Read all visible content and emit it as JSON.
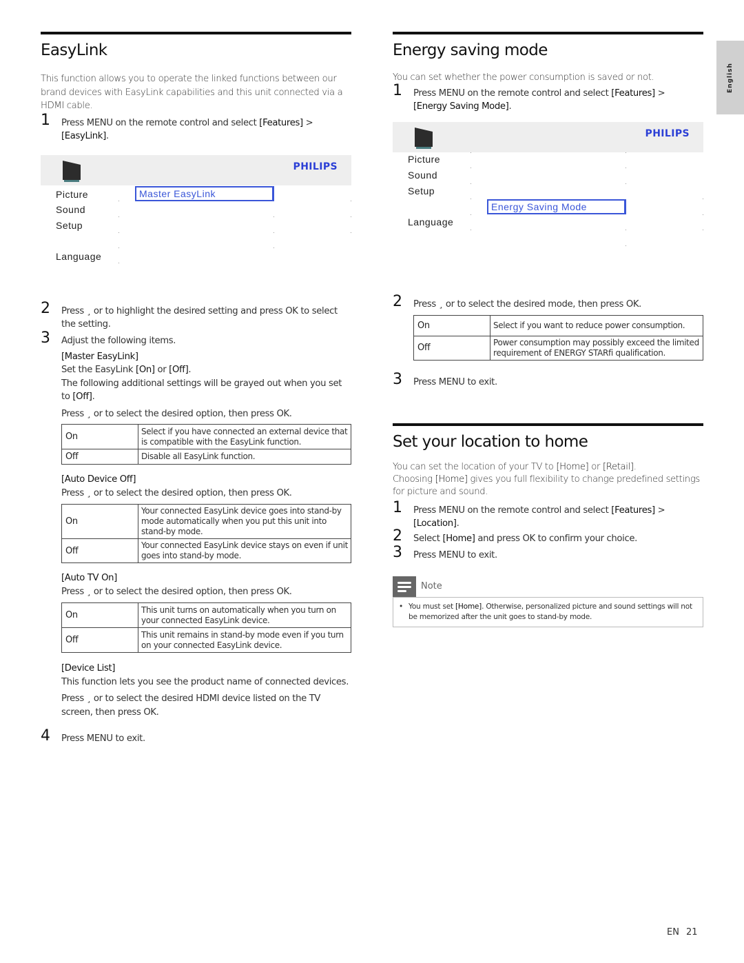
{
  "easylink": {
    "title": "EasyLink",
    "intro": "This function allows you to operate the linked functions between our brand devices with EasyLink capabilities and this unit connected via a HDMI cable.",
    "step1": {
      "num": "1",
      "pre": "Press MENU on the remote control and select ",
      "features": "[Features]",
      "mid": " > ",
      "target": "[EasyLink]",
      "post": "."
    },
    "menu": {
      "brand": "PHILIPS",
      "items": [
        "Picture",
        "Sound",
        "Setup",
        "Language"
      ],
      "highlighted": "Master EasyLink"
    },
    "step2": {
      "num": "2",
      "text": "Press ¸  or     to highlight the desired setting and press OK to select the setting."
    },
    "step3": {
      "num": "3",
      "text": "Adjust the following items."
    },
    "master": {
      "title": "[Master EasyLink]",
      "line1_pre": "Set the EasyLink ",
      "on": "[On]",
      "or": " or ",
      "off": "[Off]",
      "line1_post": ".",
      "line2_pre": "The following additional settings will be grayed out when you set to ",
      "line2_post": ".",
      "press": "Press ¸  or     to select the desired option, then press OK.",
      "rows": [
        {
          "key": "On",
          "desc": "Select if you have connected an external device that is compatible with the EasyLink function."
        },
        {
          "key": "Off",
          "desc": "Disable all EasyLink function."
        }
      ]
    },
    "auto_device_off": {
      "title": "[Auto Device Off]",
      "press": "Press ¸  or     to select the desired option, then press OK.",
      "rows": [
        {
          "key": "On",
          "desc": "Your connected EasyLink device goes into stand-by mode automatically when you put this unit into stand-by mode."
        },
        {
          "key": "Off",
          "desc": "Your connected EasyLink device stays on even if unit goes into stand-by mode."
        }
      ]
    },
    "auto_tv_on": {
      "title": "[Auto TV On]",
      "press": "Press ¸  or     to select the desired option, then press OK.",
      "rows": [
        {
          "key": "On",
          "desc": "This unit turns on automatically when you turn on your connected EasyLink device."
        },
        {
          "key": "Off",
          "desc": "This unit remains in stand-by mode even if you turn on your connected EasyLink device."
        }
      ]
    },
    "device_list": {
      "title": "[Device List]",
      "desc": "This function lets you see the product name of connected devices.",
      "press": "Press ¸  or     to select the desired HDMI device listed on the TV screen, then press OK."
    },
    "step4": {
      "num": "4",
      "text": "Press MENU to exit."
    }
  },
  "energy": {
    "title": "Energy saving mode",
    "intro": "You can set whether the power consumption is saved or not.",
    "step1": {
      "num": "1",
      "pre": "Press MENU on the remote control and select ",
      "features": "[Features]",
      "mid": " > ",
      "target": "[Energy Saving Mode]",
      "post": "."
    },
    "menu": {
      "brand": "PHILIPS",
      "items": [
        "Picture",
        "Sound",
        "Setup",
        "Language"
      ],
      "highlighted": "Energy Saving Mode"
    },
    "step2": {
      "num": "2",
      "text": "Press ¸  or     to select the desired mode, then press OK."
    },
    "rows": [
      {
        "key": "On",
        "desc": "Select if you want to reduce power consumption."
      },
      {
        "key": "Off",
        "desc": "Power consumption may possibly exceed the limited requirement of ENERGY STARfi qualification."
      }
    ],
    "step3": {
      "num": "3",
      "text": "Press MENU to exit."
    }
  },
  "location": {
    "title": "Set your location to home",
    "intro1_pre": "You can set the location of your TV to ",
    "home": "[Home]",
    "or": " or ",
    "retail": "[Retail]",
    "intro1_post": ".",
    "intro2_pre": "Choosing ",
    "intro2_post": " gives you full flexibility to change predefined settings for picture and sound.",
    "step1": {
      "num": "1",
      "pre": "Press MENU on the remote control and select ",
      "features": "[Features]",
      "mid": " > ",
      "target": "[Location]",
      "post": "."
    },
    "step2": {
      "num": "2",
      "pre": "Select ",
      "post": " and press OK to confirm your choice."
    },
    "step3": {
      "num": "3",
      "text": "Press MENU to exit."
    },
    "note": {
      "label": "Note",
      "bullet": "•",
      "pre": "You must set ",
      "post": ". Otherwise, personalized picture and sound settings will not be memorized after the unit goes to stand-by mode."
    }
  },
  "side_tab": "English",
  "footer": {
    "lang": "EN",
    "page": "21"
  }
}
